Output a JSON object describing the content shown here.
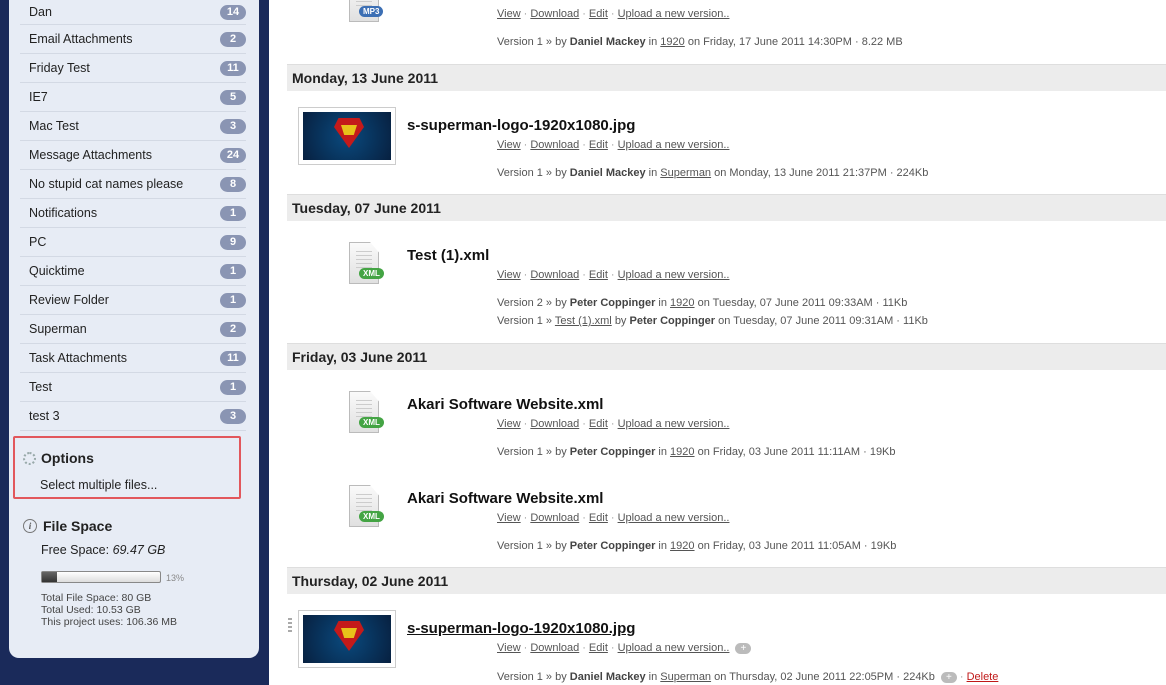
{
  "sidebar": {
    "folders": [
      {
        "label": "Dan",
        "count": "14"
      },
      {
        "label": "Email Attachments",
        "count": "2"
      },
      {
        "label": "Friday Test",
        "count": "11"
      },
      {
        "label": "IE7",
        "count": "5"
      },
      {
        "label": "Mac Test",
        "count": "3"
      },
      {
        "label": "Message Attachments",
        "count": "24"
      },
      {
        "label": "No stupid cat names please",
        "count": "8"
      },
      {
        "label": "Notifications",
        "count": "1"
      },
      {
        "label": "PC",
        "count": "9"
      },
      {
        "label": "Quicktime",
        "count": "1"
      },
      {
        "label": "Review Folder",
        "count": "1"
      },
      {
        "label": "Superman",
        "count": "2"
      },
      {
        "label": "Task Attachments",
        "count": "11"
      },
      {
        "label": "Test",
        "count": "1"
      },
      {
        "label": "test 3",
        "count": "3"
      }
    ],
    "options": {
      "title": "Options",
      "link": "Select multiple files..."
    },
    "filespace": {
      "title": "File Space",
      "free_label": "Free Space:",
      "free_value": "69.47 GB",
      "used_fraction": 0.13,
      "used_pct": "13%",
      "total": "Total File Space: 80 GB",
      "used": "Total Used: 10.53 GB",
      "project": "This project uses: 106.36 MB"
    }
  },
  "actions": {
    "view": "View",
    "download": "Download",
    "edit": "Edit",
    "upload": "Upload a new version..",
    "delete": "Delete",
    "sep": "·"
  },
  "dates": {
    "d1": "Monday, 13 June 2011",
    "d2": "Tuesday, 07 June 2011",
    "d3": "Friday, 03 June 2011",
    "d4": "Thursday, 02 June 2011"
  },
  "files": {
    "f0": {
      "icon": "mp3-file-icon",
      "tag": "MP3",
      "v1": {
        "prefix": "Version 1 » by",
        "author": "Daniel Mackey",
        "in": "in",
        "folder": "1920",
        "rest": "on Friday, 17 June 2011 14:30PM · 8.22 MB"
      }
    },
    "f1": {
      "name": "s-superman-logo-1920x1080.jpg",
      "v1": {
        "prefix": "Version 1 » by",
        "author": "Daniel Mackey",
        "in": "in",
        "folder": "Superman",
        "rest": "on Monday, 13 June 2011 21:37PM · 224Kb"
      }
    },
    "f2": {
      "name": "Test (1).xml",
      "tag": "XML",
      "v2": {
        "prefix": "Version 2 » by",
        "author": "Peter Coppinger",
        "in": "in",
        "folder": "1920",
        "rest": "on Tuesday, 07 June 2011 09:33AM · 11Kb"
      },
      "v1": {
        "prefix": "Version 1 »",
        "file": "Test (1).xml",
        "by": "by",
        "author": "Peter Coppinger",
        "rest": "on Tuesday, 07 June 2011 09:31AM · 11Kb"
      }
    },
    "f3": {
      "name": "Akari Software Website.xml",
      "tag": "XML",
      "v1": {
        "prefix": "Version 1 » by",
        "author": "Peter Coppinger",
        "in": "in",
        "folder": "1920",
        "rest": "on Friday, 03 June 2011 11:11AM · 19Kb"
      }
    },
    "f4": {
      "name": "Akari Software Website.xml",
      "tag": "XML",
      "v1": {
        "prefix": "Version 1 » by",
        "author": "Peter Coppinger",
        "in": "in",
        "folder": "1920",
        "rest": "on Friday, 03 June 2011 11:05AM · 19Kb"
      }
    },
    "f5": {
      "name": "s-superman-logo-1920x1080.jpg",
      "plus": "+",
      "v1": {
        "prefix": "Version 1 » by",
        "author": "Daniel Mackey",
        "in": "in",
        "folder": "Superman",
        "rest": "on Thursday, 02 June 2011 22:05PM · 224Kb"
      }
    }
  }
}
